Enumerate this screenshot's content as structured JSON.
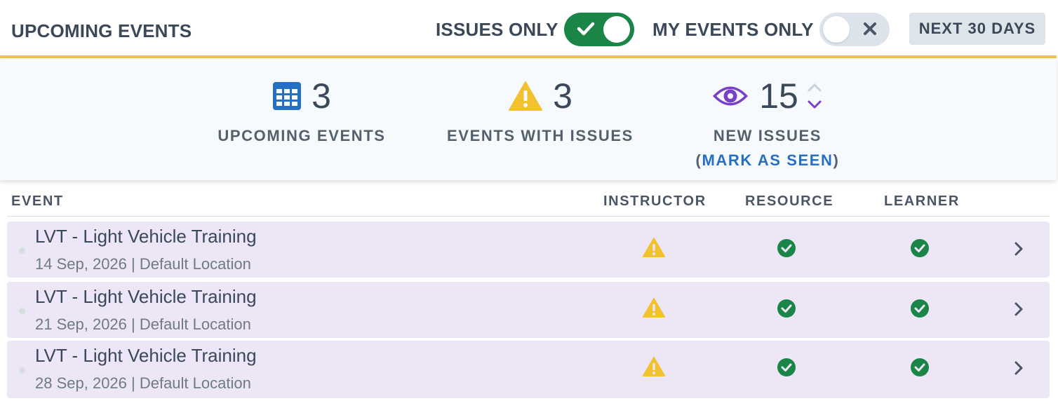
{
  "header": {
    "title": "UPCOMING EVENTS",
    "issues_only_label": "ISSUES ONLY",
    "issues_only_on": true,
    "my_events_only_label": "MY EVENTS ONLY",
    "my_events_only_on": false,
    "range_button": "NEXT 30 DAYS"
  },
  "stats": {
    "upcoming": {
      "value": "3",
      "label": "UPCOMING EVENTS",
      "icon": "calendar-icon"
    },
    "issues": {
      "value": "3",
      "label": "EVENTS WITH ISSUES",
      "icon": "warning-icon"
    },
    "new_issues": {
      "value": "15",
      "label": "NEW ISSUES",
      "paren_open": "(",
      "mark_seen": "MARK AS SEEN",
      "paren_close": ")",
      "icon": "eye-icon"
    }
  },
  "table": {
    "columns": [
      "EVENT",
      "INSTRUCTOR",
      "RESOURCE",
      "LEARNER"
    ],
    "rows": [
      {
        "title": "LVT - Light Vehicle Training",
        "sub": "14 Sep, 2026 | Default Location",
        "instructor": "warning",
        "resource": "ok",
        "learner": "ok"
      },
      {
        "title": "LVT - Light Vehicle Training",
        "sub": "21 Sep, 2026 | Default Location",
        "instructor": "warning",
        "resource": "ok",
        "learner": "ok"
      },
      {
        "title": "LVT - Light Vehicle Training",
        "sub": "28 Sep, 2026 | Default Location",
        "instructor": "warning",
        "resource": "ok",
        "learner": "ok"
      }
    ]
  },
  "colors": {
    "accent_gold": "#f0c34c",
    "toggle_on": "#1a8547",
    "warning": "#f2c12e",
    "ok": "#1a8547",
    "link": "#2670c4",
    "eye": "#7a3fc9",
    "row_bg": "#ece6f6"
  }
}
